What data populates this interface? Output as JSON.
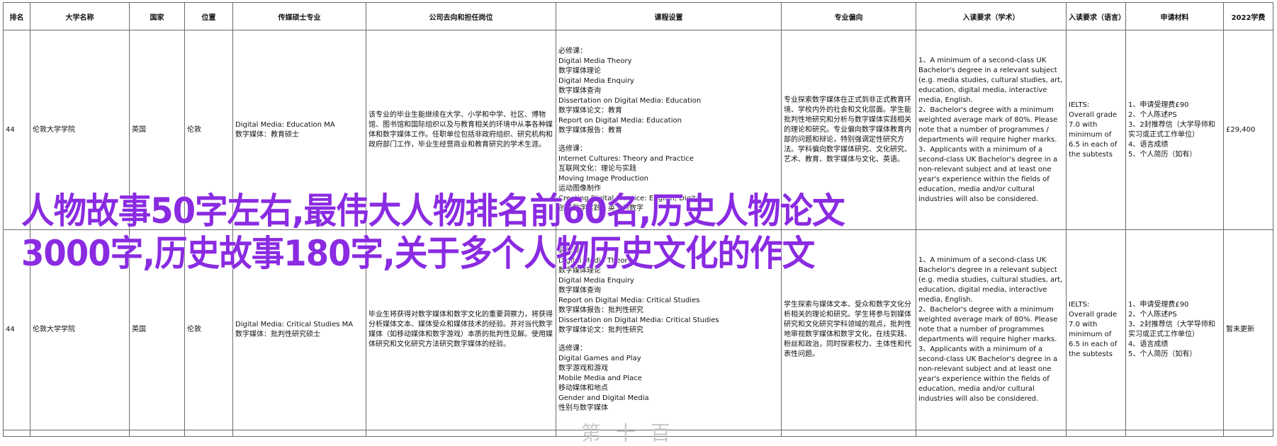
{
  "headers": [
    "排名",
    "大学名称",
    "国家",
    "位置",
    "传媒硕士专业",
    "公司去向和担任岗位",
    "课程设置",
    "专业偏向",
    "入读要求（学术）",
    "入读要求（语言）",
    "申请材料",
    "2022学费"
  ],
  "rows": [
    {
      "rank": "44",
      "university": "伦敦大学学院",
      "country": "英国",
      "location": "伦敦",
      "major": [
        "Digital Media: Education MA",
        "数字媒体：教育硕士"
      ],
      "career": "该专业的毕业生能继续在大学、小学和中学、社区、博物馆、图书馆和国际组织以及与教育相关的环境中从事各种媒体和数字媒体工作。任职单位包括非政府组织、研究机构和政府部门工作，毕业生经营商业和教育研究的学术生涯。",
      "courses": [
        "必修课：",
        "Digital Media Theory",
        "数字媒体理论",
        "Digital Media Enquiry",
        "数字媒体查询",
        "Dissertation on Digital Media: Education",
        "数字媒体论文：教育",
        "Report on Digital Media: Education",
        "数字媒体报告：教育",
        "",
        "选修课：",
        "Internet Cultures: Theory and Practice",
        "互联网文化：理论与实践",
        "Moving Image Production",
        "运动图像制作",
        "Creating Digital Practice: English, Digital",
        "创意数字实践：英文与数字"
      ],
      "focus": "专业探索数字媒体在正式到非正式教育环境、学校内外的社会和文化层面。学生能批判性地研究和分析与数字媒体实践相关的理论和研究。专业偏向数字媒体教育内部的问题和辩论，特别强调定性研究方法。学科偏向数字媒体研究、文化研究、艺术、教育、数字媒体与文化、英语。",
      "academic": "1、A minimum of a second-class UK Bachelor's degree in a relevant subject (e.g. media studies, cultural studies, art, education, digital media, interactive media, English.\n2、Bachelor's degree with a minimum weighted average mark of 80%. Please note that a number of programmes / departments will require higher marks.\n3、Applicants with a minimum of a second-class UK Bachelor's degree in a non-relevant subject and at least one year's experience within the fields of education, media and/or cultural industries will also be considered.",
      "language": "IELTS:\nOverall grade 7.0 with minimum of 6.5 in each of the subtests",
      "materials": "1、申请受理费£90\n2、个人陈述PS\n3、2封推荐信（大学导师和实习或正式工作单位）\n4、语言成绩\n5、个人简历（如有）",
      "fee": "£29,400"
    },
    {
      "rank": "44",
      "university": "伦敦大学学院",
      "country": "英国",
      "location": "伦敦",
      "major": [
        "Digital Media: Critical Studies MA",
        "数字媒体：批判性研究硕士"
      ],
      "career": "毕业生将获得对数字媒体和数字文化的重要洞察力，将获得分析媒体文本、媒体受众和媒体技术的经验。并对当代数字媒体（如移动媒体和数字游戏）本质的批判性见解。使用媒体研究和文化研究方法研究数字媒体的经验。",
      "courses": [
        "必修课：",
        "Digital Media Theory",
        "数字媒体理论",
        "Digital Media Enquiry",
        "数字媒体查询",
        "Report on Digital Media: Critical Studies",
        "数字媒体报告：批判性研究",
        "Dissertation on Digital Media: Critical Studies",
        "数字媒体论文：批判性研究",
        "",
        "选修课：",
        "Digital Games and Play",
        "数字游戏和游戏",
        "Mobile Media and Place",
        "移动媒体和地点",
        "Gender and Digital Media",
        "性别与数字媒体"
      ],
      "focus": "学生探索与媒体文本、受众和数字文化分析相关的理论和研究。学生将参与到媒体研究和文化研究学科领域的观点，批判性地审视数字媒体和数字文化，在线实践、粉丝和政治，同时探索权力、主体性和代表性问题。",
      "academic": "1、A minimum of a second-class UK Bachelor's degree in a relevant subject (e.g. media studies, cultural studies, art, education, digital media, interactive media, English.\n2、Bachelor's degree with a minimum weighted average mark of 80%. Please note that a number of programmes departments will require higher marks.\n3、Applicants with a minimum of a second-class UK Bachelor's degree in a non-relevant subject and at least one year's experience within the fields of education, media and/or cultural industries will also be considered.",
      "language": "IELTS:\nOverall grade 7.0 with minimum of 6.5 in each of the subtests",
      "materials": "1、申请受理费£90\n2、个人陈述PS\n3、2封推荐信（大学导师和实习或正式工作单位）\n4、语言成绩\n5、个人简历（如有）",
      "fee": "暂未更新"
    }
  ],
  "overlay": {
    "line1": "人物故事50字左右,最伟大人物排名前60名,历史人物论文",
    "line2": "3000字,历史故事180字,关于多个人物历史文化的作文"
  },
  "bottom_partial_text": "第 十 百",
  "colors": {
    "overlay": "#8a2be2",
    "selection": "#1aa782",
    "grid": "#6b6b6b"
  }
}
